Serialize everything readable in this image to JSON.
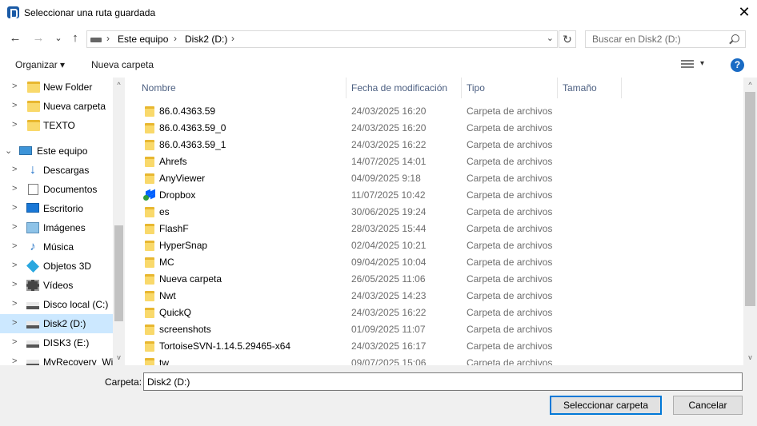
{
  "window": {
    "title": "Seleccionar una ruta guardada",
    "close_glyph": "✕"
  },
  "nav": {
    "back": "←",
    "forward": "→",
    "recent": "⌄",
    "up": "↑",
    "breadcrumb": [
      "Este equipo",
      "Disk2 (D:)"
    ],
    "sep": "›",
    "dropdown": "⌄",
    "refresh": "↻",
    "search_placeholder": "Buscar en Disk2 (D:)"
  },
  "toolbar": {
    "organize": "Organizar ▾",
    "new_folder": "Nueva carpeta",
    "view_dd": "▾",
    "help": "?"
  },
  "tree": [
    {
      "label": "New Folder",
      "icon": "folder-icon",
      "chevron": ">"
    },
    {
      "label": "Nueva carpeta",
      "icon": "folder-icon",
      "chevron": ">"
    },
    {
      "label": "TEXTO",
      "icon": "folder-icon",
      "chevron": ">"
    },
    {
      "label": "Este equipo",
      "icon": "computer-icon",
      "chevron": "⌄"
    },
    {
      "label": "Descargas",
      "icon": "downloads-icon",
      "chevron": ">"
    },
    {
      "label": "Documentos",
      "icon": "documents-icon",
      "chevron": ">"
    },
    {
      "label": "Escritorio",
      "icon": "desktop-icon",
      "chevron": ">"
    },
    {
      "label": "Imágenes",
      "icon": "pictures-icon",
      "chevron": ">"
    },
    {
      "label": "Música",
      "icon": "music-icon",
      "chevron": ">"
    },
    {
      "label": "Objetos 3D",
      "icon": "3d-objects-icon",
      "chevron": ">"
    },
    {
      "label": "Vídeos",
      "icon": "videos-icon",
      "chevron": ">"
    },
    {
      "label": "Disco local (C:)",
      "icon": "local-disk-icon",
      "chevron": ">"
    },
    {
      "label": "Disk2 (D:)",
      "icon": "drive-icon",
      "chevron": ">"
    },
    {
      "label": "DISK3 (E:)",
      "icon": "drive-icon",
      "chevron": ">"
    },
    {
      "label": "MyRecovery_Wi",
      "icon": "drive-icon",
      "chevron": ">"
    }
  ],
  "columns": {
    "name": "Nombre",
    "date": "Fecha de modificación",
    "type": "Tipo",
    "size": "Tamaño",
    "sort_glyph": "^"
  },
  "files": [
    {
      "name": "86.0.4363.59",
      "date": "24/03/2025 16:20",
      "type": "Carpeta de archivos",
      "icon": "folder-icon"
    },
    {
      "name": "86.0.4363.59_0",
      "date": "24/03/2025 16:20",
      "type": "Carpeta de archivos",
      "icon": "folder-icon"
    },
    {
      "name": "86.0.4363.59_1",
      "date": "24/03/2025 16:22",
      "type": "Carpeta de archivos",
      "icon": "folder-icon"
    },
    {
      "name": "Ahrefs",
      "date": "14/07/2025 14:01",
      "type": "Carpeta de archivos",
      "icon": "folder-icon"
    },
    {
      "name": "AnyViewer",
      "date": "04/09/2025 9:18",
      "type": "Carpeta de archivos",
      "icon": "folder-icon"
    },
    {
      "name": "Dropbox",
      "date": "11/07/2025 10:42",
      "type": "Carpeta de archivos",
      "icon": "dropbox-icon"
    },
    {
      "name": "es",
      "date": "30/06/2025 19:24",
      "type": "Carpeta de archivos",
      "icon": "folder-icon"
    },
    {
      "name": "FlashF",
      "date": "28/03/2025 15:44",
      "type": "Carpeta de archivos",
      "icon": "folder-icon"
    },
    {
      "name": "HyperSnap",
      "date": "02/04/2025 10:21",
      "type": "Carpeta de archivos",
      "icon": "folder-icon"
    },
    {
      "name": "MC",
      "date": "09/04/2025 10:04",
      "type": "Carpeta de archivos",
      "icon": "folder-icon"
    },
    {
      "name": "Nueva carpeta",
      "date": "26/05/2025 11:06",
      "type": "Carpeta de archivos",
      "icon": "folder-icon"
    },
    {
      "name": "Nwt",
      "date": "24/03/2025 14:23",
      "type": "Carpeta de archivos",
      "icon": "folder-icon"
    },
    {
      "name": "QuickQ",
      "date": "24/03/2025 16:22",
      "type": "Carpeta de archivos",
      "icon": "folder-icon"
    },
    {
      "name": "screenshots",
      "date": "01/09/2025 11:07",
      "type": "Carpeta de archivos",
      "icon": "folder-icon"
    },
    {
      "name": "TortoiseSVN-1.14.5.29465-x64",
      "date": "24/03/2025 16:17",
      "type": "Carpeta de archivos",
      "icon": "folder-icon"
    },
    {
      "name": "tw",
      "date": "09/07/2025 15:06",
      "type": "Carpeta de archivos",
      "icon": "folder-icon"
    }
  ],
  "footer": {
    "folder_label": "Carpeta:",
    "folder_value": "Disk2 (D:)",
    "select_button": "Seleccionar carpeta",
    "cancel_button": "Cancelar"
  },
  "scroll_glyphs": {
    "up": "^",
    "down": "v"
  },
  "colors": {
    "selected_bg": "#cce8ff",
    "folder_yellow": "#f9d96b",
    "accent": "#0078d7"
  }
}
